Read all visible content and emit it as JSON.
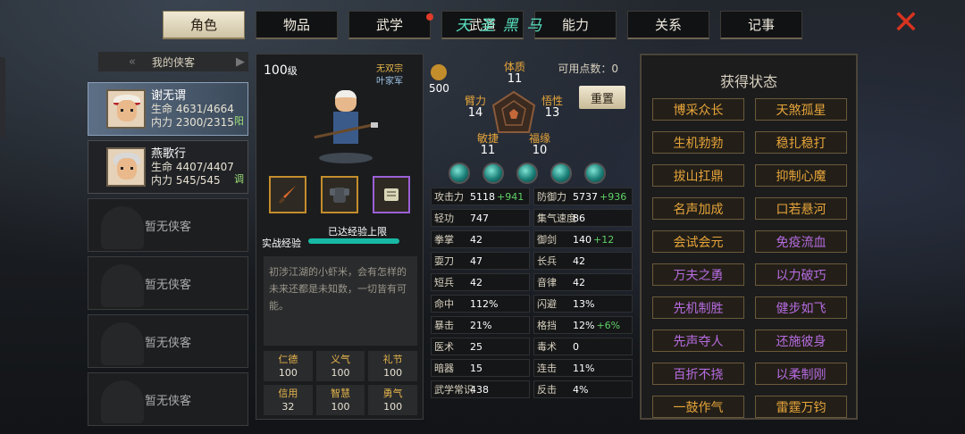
{
  "tabs": [
    {
      "label": "角色",
      "active": true
    },
    {
      "label": "物品"
    },
    {
      "label": "武学",
      "badge": true
    },
    {
      "label": "武道"
    },
    {
      "label": "能力"
    },
    {
      "label": "关系"
    },
    {
      "label": "记事"
    }
  ],
  "overlay_text": "天 圣 黑 马",
  "roster": {
    "title": "我的侠客",
    "heroes": [
      {
        "name": "谢无谓",
        "hp": "生命 4631/4664",
        "mp": "内力 2300/2315",
        "tag": "阳"
      },
      {
        "name": "燕歌行",
        "hp": "生命 4407/4407",
        "mp": "内力 545/545",
        "tag": "调"
      }
    ],
    "empty_label": "暂无侠客"
  },
  "char": {
    "level": "100",
    "level_unit": "级",
    "faction1": "无双宗",
    "faction2": "叶家军",
    "exp_label": "实战经验",
    "exp_text": "已达经验上限",
    "exp_fill": 1.0,
    "desc": "初涉江湖的小虾米，会有怎样的未来还都是未知数，一切皆有可能。",
    "virtues": [
      {
        "k": "仁德",
        "v": "100"
      },
      {
        "k": "义气",
        "v": "100"
      },
      {
        "k": "礼节",
        "v": "100"
      },
      {
        "k": "信用",
        "v": "32"
      },
      {
        "k": "智慧",
        "v": "100"
      },
      {
        "k": "勇气",
        "v": "100"
      }
    ]
  },
  "attrs": {
    "potential": "500",
    "points_label": "可用点数：0",
    "reset": "重置",
    "stats": {
      "tizhi": {
        "k": "体质",
        "v": "11"
      },
      "bili": {
        "k": "臂力",
        "v": "14"
      },
      "wuxing": {
        "k": "悟性",
        "v": "13"
      },
      "minjie": {
        "k": "敏捷",
        "v": "11"
      },
      "fuyuan": {
        "k": "福缘",
        "v": "10"
      }
    },
    "grid": [
      {
        "k": "攻击力",
        "v": "5118",
        "g": "+941"
      },
      {
        "k": "防御力",
        "v": "5737",
        "g": "+936"
      },
      {
        "k": "轻功",
        "v": "747"
      },
      {
        "k": "集气速度",
        "v": "86"
      },
      {
        "k": "拳掌",
        "v": "42"
      },
      {
        "k": "御剑",
        "v": "140",
        "g": "+12"
      },
      {
        "k": "耍刀",
        "v": "47"
      },
      {
        "k": "长兵",
        "v": "42"
      },
      {
        "k": "短兵",
        "v": "42"
      },
      {
        "k": "音律",
        "v": "42"
      },
      {
        "k": "命中",
        "v": "112%"
      },
      {
        "k": "闪避",
        "v": "13%"
      },
      {
        "k": "暴击",
        "v": "21%"
      },
      {
        "k": "格挡",
        "v": "12%",
        "g": "+6%"
      },
      {
        "k": "医术",
        "v": "25"
      },
      {
        "k": "毒术",
        "v": "0"
      },
      {
        "k": "暗器",
        "v": "15"
      },
      {
        "k": "连击",
        "v": "11%"
      },
      {
        "k": "武学常识",
        "v": "438"
      },
      {
        "k": "反击",
        "v": "4%"
      }
    ]
  },
  "status": {
    "title": "获得状态",
    "items": [
      {
        "label": "博采众长",
        "color": "gold"
      },
      {
        "label": "天煞孤星",
        "color": "gold"
      },
      {
        "label": "生机勃勃",
        "color": "gold"
      },
      {
        "label": "稳扎稳打",
        "color": "gold"
      },
      {
        "label": "拔山扛鼎",
        "color": "gold"
      },
      {
        "label": "抑制心魔",
        "color": "gold"
      },
      {
        "label": "名声加成",
        "color": "gold"
      },
      {
        "label": "口若悬河",
        "color": "gold"
      },
      {
        "label": "会试会元",
        "color": "gold"
      },
      {
        "label": "免疫流血",
        "color": "purple"
      },
      {
        "label": "万夫之勇",
        "color": "purple"
      },
      {
        "label": "以力破巧",
        "color": "purple"
      },
      {
        "label": "先机制胜",
        "color": "purple"
      },
      {
        "label": "健步如飞",
        "color": "purple"
      },
      {
        "label": "先声夺人",
        "color": "purple"
      },
      {
        "label": "还施彼身",
        "color": "purple"
      },
      {
        "label": "百折不挠",
        "color": "purple"
      },
      {
        "label": "以柔制刚",
        "color": "purple"
      },
      {
        "label": "一鼓作气",
        "color": "gold"
      },
      {
        "label": "雷霆万钧",
        "color": "gold"
      }
    ]
  },
  "icons": [
    "close-icon",
    "sword-icon",
    "armor-icon",
    "accessory-icon",
    "potential-icon",
    "hexagon-icon",
    "gem-icon"
  ]
}
